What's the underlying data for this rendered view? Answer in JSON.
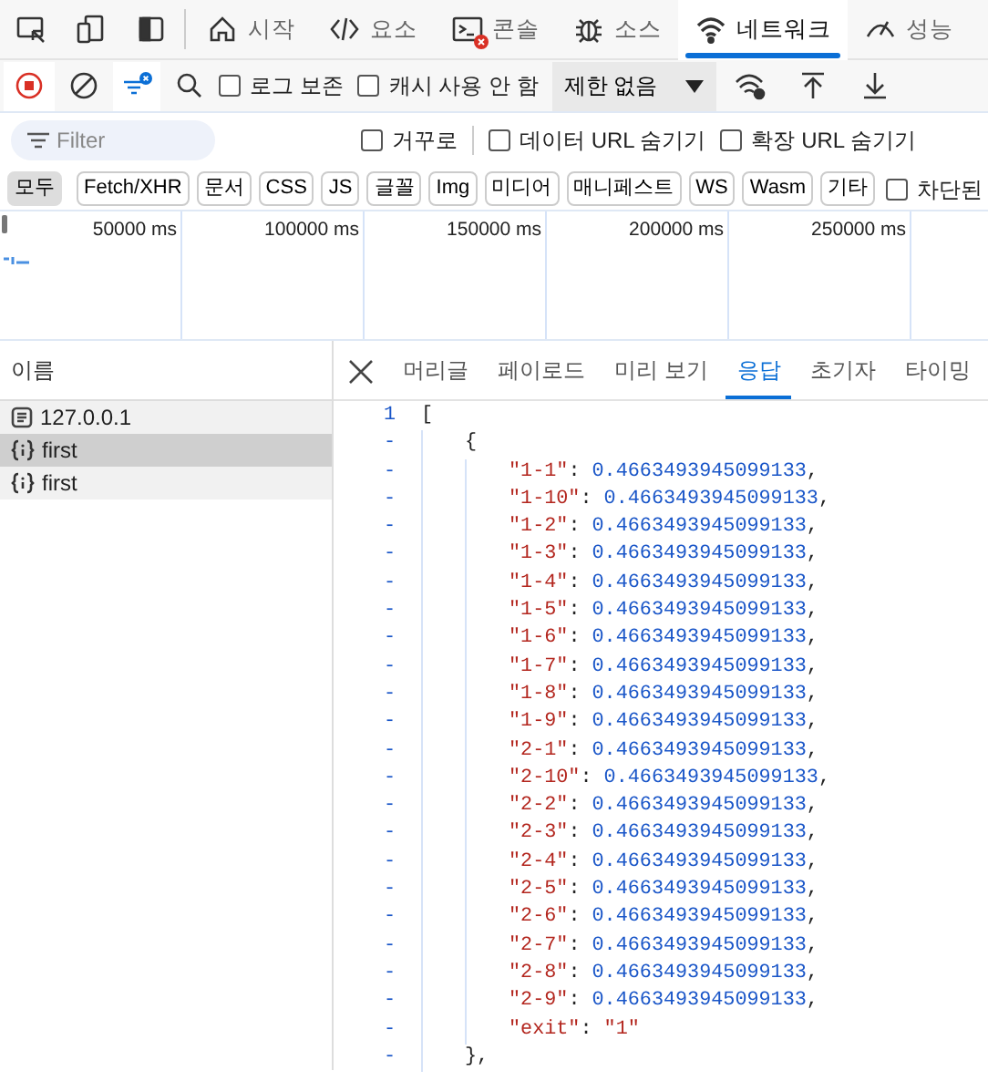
{
  "devtools_tabs": [
    {
      "label": "시작",
      "selected": false
    },
    {
      "label": "요소",
      "selected": false
    },
    {
      "label": "콘솔",
      "selected": false,
      "error_badge": true
    },
    {
      "label": "소스",
      "selected": false
    },
    {
      "label": "네트워크",
      "selected": true
    },
    {
      "label": "성능",
      "selected": false
    }
  ],
  "toolbar": {
    "recording": true,
    "filter_active": true,
    "checkboxes": [
      {
        "label": "로그 보존",
        "checked": false
      },
      {
        "label": "캐시 사용 안 함",
        "checked": false
      }
    ],
    "throttle": "제한 없음"
  },
  "filter": {
    "placeholder": "Filter",
    "checkboxes": [
      {
        "label": "거꾸로",
        "checked": false
      },
      {
        "label": "데이터 URL 숨기기",
        "checked": false
      },
      {
        "label": "확장 URL 숨기기",
        "checked": false
      }
    ]
  },
  "type_filters": [
    {
      "label": "모두",
      "selected": true
    },
    {
      "label": "Fetch/XHR",
      "selected": false
    },
    {
      "label": "문서",
      "selected": false
    },
    {
      "label": "CSS",
      "selected": false
    },
    {
      "label": "JS",
      "selected": false
    },
    {
      "label": "글꼴",
      "selected": false
    },
    {
      "label": "Img",
      "selected": false
    },
    {
      "label": "미디어",
      "selected": false
    },
    {
      "label": "매니페스트",
      "selected": false
    },
    {
      "label": "WS",
      "selected": false
    },
    {
      "label": "Wasm",
      "selected": false
    },
    {
      "label": "기타",
      "selected": false
    }
  ],
  "blocked_checkbox": {
    "label": "차단된",
    "checked": false
  },
  "timeline": {
    "ticks": [
      "50000 ms",
      "100000 ms",
      "150000 ms",
      "200000 ms",
      "250000 ms"
    ]
  },
  "requests": {
    "header": "이름",
    "rows": [
      {
        "name": "127.0.0.1",
        "kind": "document",
        "selected": false
      },
      {
        "name": "first",
        "kind": "fetch",
        "selected": true
      },
      {
        "name": "first",
        "kind": "fetch",
        "selected": false
      }
    ]
  },
  "detail_tabs": [
    {
      "label": "머리글",
      "selected": false
    },
    {
      "label": "페이로드",
      "selected": false
    },
    {
      "label": "미리 보기",
      "selected": false
    },
    {
      "label": "응답",
      "selected": true
    },
    {
      "label": "초기자",
      "selected": false
    },
    {
      "label": "타이밍",
      "selected": false
    }
  ],
  "response_lines": [
    {
      "gutter": "1",
      "kind": "open_array",
      "text": "["
    },
    {
      "gutter": "-",
      "kind": "open_object",
      "text": "{"
    },
    {
      "gutter": "-",
      "kind": "number_entry",
      "key": "\"1-1\"",
      "colon": ":",
      "value": "0.4663493945099133",
      "trailing": ","
    },
    {
      "gutter": "-",
      "kind": "number_entry",
      "key": "\"1-10\"",
      "colon": ":",
      "value": "0.4663493945099133",
      "trailing": ","
    },
    {
      "gutter": "-",
      "kind": "number_entry",
      "key": "\"1-2\"",
      "colon": ":",
      "value": "0.4663493945099133",
      "trailing": ","
    },
    {
      "gutter": "-",
      "kind": "number_entry",
      "key": "\"1-3\"",
      "colon": ":",
      "value": "0.4663493945099133",
      "trailing": ","
    },
    {
      "gutter": "-",
      "kind": "number_entry",
      "key": "\"1-4\"",
      "colon": ":",
      "value": "0.4663493945099133",
      "trailing": ","
    },
    {
      "gutter": "-",
      "kind": "number_entry",
      "key": "\"1-5\"",
      "colon": ":",
      "value": "0.4663493945099133",
      "trailing": ","
    },
    {
      "gutter": "-",
      "kind": "number_entry",
      "key": "\"1-6\"",
      "colon": ":",
      "value": "0.4663493945099133",
      "trailing": ","
    },
    {
      "gutter": "-",
      "kind": "number_entry",
      "key": "\"1-7\"",
      "colon": ":",
      "value": "0.4663493945099133",
      "trailing": ","
    },
    {
      "gutter": "-",
      "kind": "number_entry",
      "key": "\"1-8\"",
      "colon": ":",
      "value": "0.4663493945099133",
      "trailing": ","
    },
    {
      "gutter": "-",
      "kind": "number_entry",
      "key": "\"1-9\"",
      "colon": ":",
      "value": "0.4663493945099133",
      "trailing": ","
    },
    {
      "gutter": "-",
      "kind": "number_entry",
      "key": "\"2-1\"",
      "colon": ":",
      "value": "0.4663493945099133",
      "trailing": ","
    },
    {
      "gutter": "-",
      "kind": "number_entry",
      "key": "\"2-10\"",
      "colon": ":",
      "value": "0.4663493945099133",
      "trailing": ","
    },
    {
      "gutter": "-",
      "kind": "number_entry",
      "key": "\"2-2\"",
      "colon": ":",
      "value": "0.4663493945099133",
      "trailing": ","
    },
    {
      "gutter": "-",
      "kind": "number_entry",
      "key": "\"2-3\"",
      "colon": ":",
      "value": "0.4663493945099133",
      "trailing": ","
    },
    {
      "gutter": "-",
      "kind": "number_entry",
      "key": "\"2-4\"",
      "colon": ":",
      "value": "0.4663493945099133",
      "trailing": ","
    },
    {
      "gutter": "-",
      "kind": "number_entry",
      "key": "\"2-5\"",
      "colon": ":",
      "value": "0.4663493945099133",
      "trailing": ","
    },
    {
      "gutter": "-",
      "kind": "number_entry",
      "key": "\"2-6\"",
      "colon": ":",
      "value": "0.4663493945099133",
      "trailing": ","
    },
    {
      "gutter": "-",
      "kind": "number_entry",
      "key": "\"2-7\"",
      "colon": ":",
      "value": "0.4663493945099133",
      "trailing": ","
    },
    {
      "gutter": "-",
      "kind": "number_entry",
      "key": "\"2-8\"",
      "colon": ":",
      "value": "0.4663493945099133",
      "trailing": ","
    },
    {
      "gutter": "-",
      "kind": "number_entry",
      "key": "\"2-9\"",
      "colon": ":",
      "value": "0.4663493945099133",
      "trailing": ","
    },
    {
      "gutter": "-",
      "kind": "string_entry",
      "key": "\"exit\"",
      "colon": ":",
      "value": "\"1\""
    },
    {
      "gutter": "-",
      "kind": "close_object",
      "text": "},"
    }
  ]
}
